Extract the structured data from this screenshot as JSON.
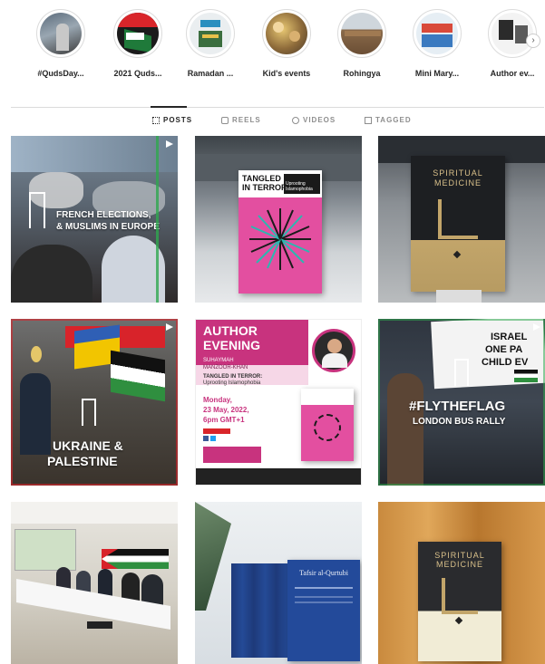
{
  "highlights": [
    {
      "label": "#QudsDay..."
    },
    {
      "label": "2021 Quds..."
    },
    {
      "label": "Ramadan ..."
    },
    {
      "label": "Kid's events"
    },
    {
      "label": "Rohingya"
    },
    {
      "label": "Mini Mary..."
    },
    {
      "label": "Author ev..."
    }
  ],
  "tabs": {
    "posts": "POSTS",
    "reels": "REELS",
    "videos": "VIDEOS",
    "tagged": "TAGGED"
  },
  "posts": {
    "p1": {
      "line1": "FRENCH ELECTIONS,",
      "line2": "& MUSLIMS IN EUROPE"
    },
    "p2": {
      "title_a": "TANGLED",
      "title_b": "IN TERROR",
      "sub": "Uprooting Islamophobia"
    },
    "p3": {
      "kicker": "",
      "title": "SPIRITUAL",
      "title2": "MEDICINE"
    },
    "p4": {
      "line1": "UKRAINE &",
      "line2": "PALESTINE"
    },
    "p5": {
      "head1": "AUTHOR",
      "head2": "EVENING",
      "name1": "SUHAYMAH",
      "name2": "MANZOOR-KHAN",
      "book": "TANGLED IN TERROR:",
      "book2": "Uprooting Islamophobia",
      "date1": "Monday,",
      "date2": "23 May, 2022,",
      "time": "6pm GMT+1"
    },
    "p6": {
      "line1": "#FLYTHEFLAG",
      "line2": "LONDON BUS RALLY",
      "sign1": "ISRAEL",
      "sign2": "ONE PA",
      "sign3": "CHILD EV"
    },
    "p8": {
      "title": "Tafsir al-Qurtubi"
    },
    "p9": {
      "title": "SPIRITUAL",
      "title2": "MEDICINE"
    }
  }
}
